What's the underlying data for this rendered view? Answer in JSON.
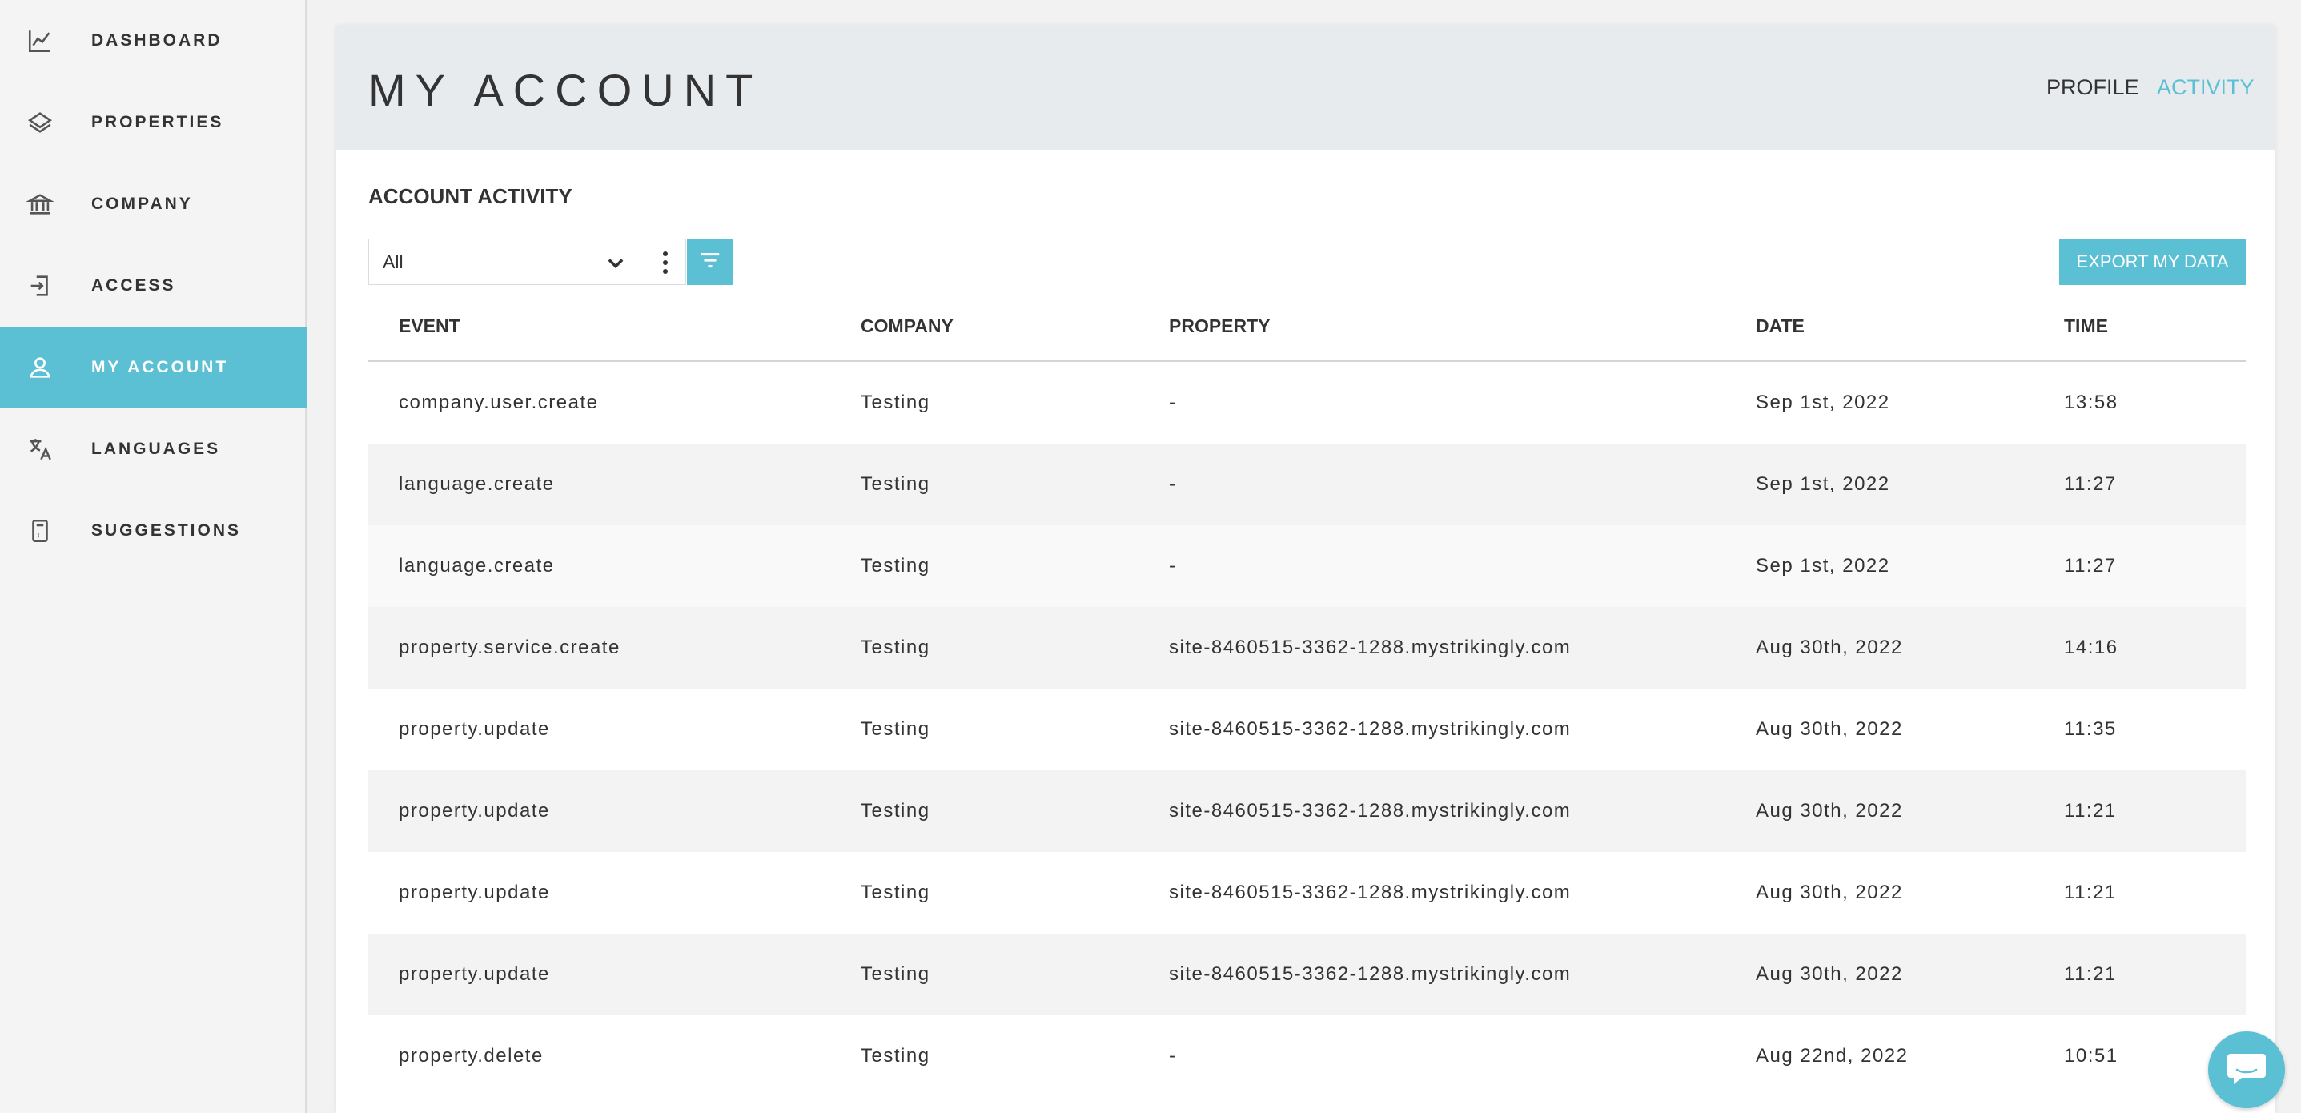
{
  "sidebar": {
    "items": [
      {
        "label": "DASHBOARD",
        "icon": "chart-line-icon"
      },
      {
        "label": "PROPERTIES",
        "icon": "layers-icon"
      },
      {
        "label": "COMPANY",
        "icon": "bank-icon"
      },
      {
        "label": "ACCESS",
        "icon": "login-icon"
      },
      {
        "label": "MY ACCOUNT",
        "icon": "user-icon",
        "active": true
      },
      {
        "label": "LANGUAGES",
        "icon": "translate-icon"
      },
      {
        "label": "SUGGESTIONS",
        "icon": "suggestion-box-icon"
      }
    ]
  },
  "header": {
    "title": "MY ACCOUNT",
    "tabs": [
      {
        "label": "PROFILE"
      },
      {
        "label": "ACTIVITY",
        "active": true
      }
    ]
  },
  "section": {
    "title": "ACCOUNT ACTIVITY"
  },
  "filter": {
    "selected": "All"
  },
  "export": {
    "label": "EXPORT MY DATA"
  },
  "table": {
    "columns": [
      "EVENT",
      "COMPANY",
      "PROPERTY",
      "DATE",
      "TIME"
    ],
    "rows": [
      {
        "event": "company.user.create",
        "company": "Testing",
        "property": "-",
        "date": "Sep 1st, 2022",
        "time": "13:58"
      },
      {
        "event": "language.create",
        "company": "Testing",
        "property": "-",
        "date": "Sep 1st, 2022",
        "time": "11:27"
      },
      {
        "event": "language.create",
        "company": "Testing",
        "property": "-",
        "date": "Sep 1st, 2022",
        "time": "11:27"
      },
      {
        "event": "property.service.create",
        "company": "Testing",
        "property": "site-8460515-3362-1288.mystrikingly.com",
        "date": "Aug 30th, 2022",
        "time": "14:16"
      },
      {
        "event": "property.update",
        "company": "Testing",
        "property": "site-8460515-3362-1288.mystrikingly.com",
        "date": "Aug 30th, 2022",
        "time": "11:35"
      },
      {
        "event": "property.update",
        "company": "Testing",
        "property": "site-8460515-3362-1288.mystrikingly.com",
        "date": "Aug 30th, 2022",
        "time": "11:21"
      },
      {
        "event": "property.update",
        "company": "Testing",
        "property": "site-8460515-3362-1288.mystrikingly.com",
        "date": "Aug 30th, 2022",
        "time": "11:21"
      },
      {
        "event": "property.update",
        "company": "Testing",
        "property": "site-8460515-3362-1288.mystrikingly.com",
        "date": "Aug 30th, 2022",
        "time": "11:21"
      },
      {
        "event": "property.delete",
        "company": "Testing",
        "property": "-",
        "date": "Aug 22nd, 2022",
        "time": "10:51"
      }
    ]
  },
  "colors": {
    "accent": "#5cc0d4",
    "header_bg": "#e8ebee",
    "sidebar_bg": "#f4f4f4"
  }
}
